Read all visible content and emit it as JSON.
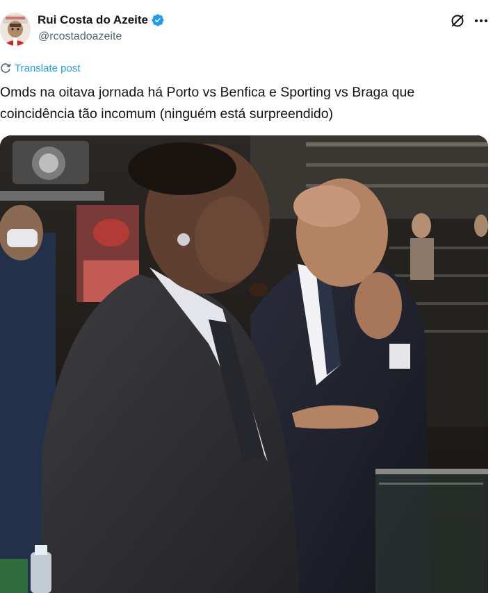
{
  "author": {
    "display_name": "Rui Costa do Azeite",
    "handle": "@rcostadoazeite",
    "verified": true,
    "avatar_icon": "avatar-image"
  },
  "header_actions": {
    "grok_icon": "grok-slash-icon",
    "more_icon": "more-dots-icon"
  },
  "translate": {
    "label": "Translate post",
    "icon": "translate-icon"
  },
  "post": {
    "text": "Omds na oitava jornada há Porto vs Benfica e Sporting vs Braga que coincidência tão incomum (ninguém está surpreendido)"
  },
  "media": {
    "type": "video-still",
    "icon": "media-image"
  },
  "colors": {
    "accent": "#1d9bf0",
    "secondary_text": "#536471",
    "primary_text": "#0f1419",
    "background": "#ffffff"
  }
}
